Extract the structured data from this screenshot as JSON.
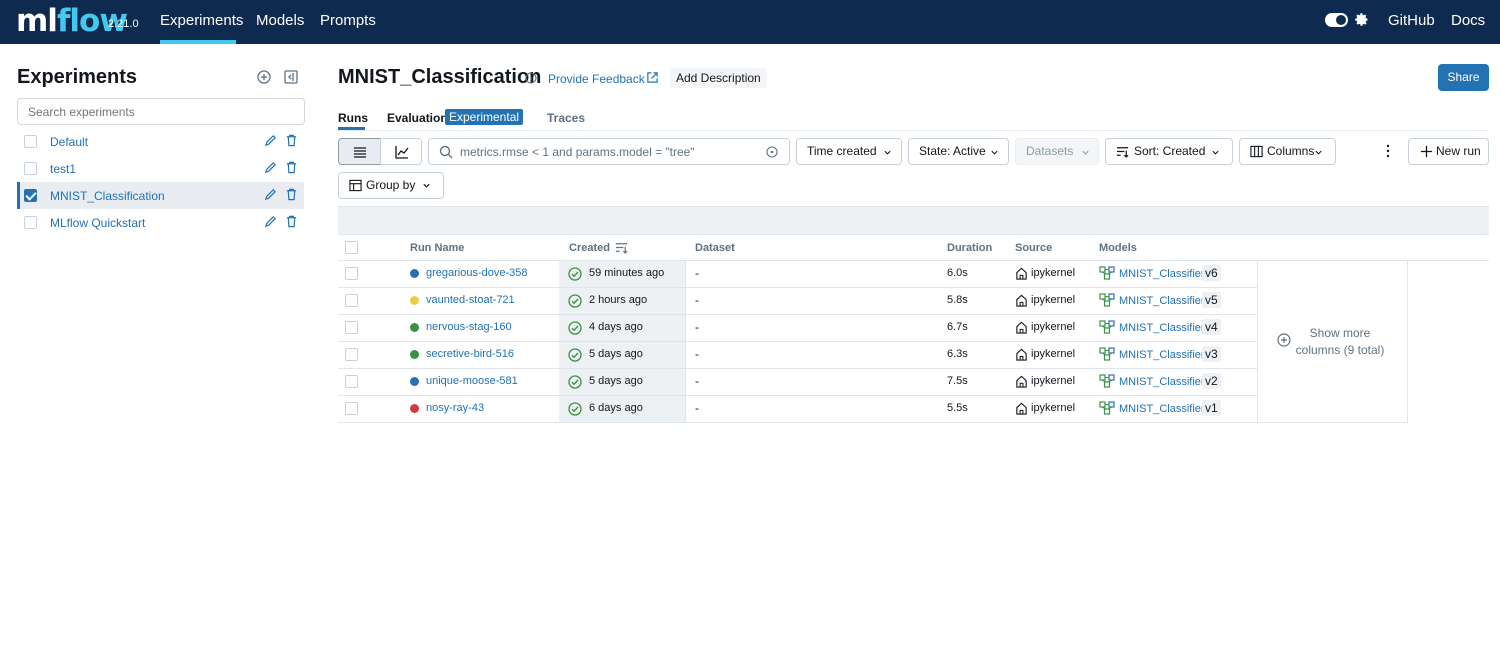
{
  "nav": {
    "logo_ml": "ml",
    "logo_flow": "flow",
    "version": "2.21.0",
    "items": [
      "Experiments",
      "Models",
      "Prompts"
    ],
    "github": "GitHub",
    "docs": "Docs"
  },
  "sidebar": {
    "title": "Experiments",
    "search_placeholder": "Search experiments",
    "experiments": [
      {
        "name": "Default",
        "checked": false
      },
      {
        "name": "test1",
        "checked": false
      },
      {
        "name": "MNIST_Classification",
        "checked": true
      },
      {
        "name": "MLflow Quickstart",
        "checked": false
      }
    ]
  },
  "header": {
    "title": "MNIST_Classification",
    "feedback": "Provide Feedback",
    "add_description": "Add Description",
    "share": "Share"
  },
  "tabs": {
    "runs": "Runs",
    "evaluation": "Evaluation",
    "evaluation_badge": "Experimental",
    "traces": "Traces"
  },
  "toolbar": {
    "filter_placeholder": "metrics.rmse < 1 and params.model = \"tree\"",
    "time_created": "Time created",
    "state": "State: Active",
    "datasets": "Datasets",
    "sort": "Sort: Created",
    "columns": "Columns",
    "new_run": "New run",
    "group_by": "Group by"
  },
  "table": {
    "headers": {
      "run_name": "Run Name",
      "created": "Created",
      "dataset": "Dataset",
      "duration": "Duration",
      "source": "Source",
      "models": "Models"
    },
    "rows": [
      {
        "name": "gregarious-dove-358",
        "color": "#2d6db5",
        "created": "59 minutes ago",
        "dataset": "-",
        "duration": "6.0s",
        "source": "ipykernel_launcher",
        "model": "MNIST_Classifier",
        "version": "v6"
      },
      {
        "name": "vaunted-stoat-721",
        "color": "#f0c94a",
        "created": "2 hours ago",
        "dataset": "-",
        "duration": "5.8s",
        "source": "ipykernel_launcher",
        "model": "MNIST_Classifier",
        "version": "v5"
      },
      {
        "name": "nervous-stag-160",
        "color": "#3a9144",
        "created": "4 days ago",
        "dataset": "-",
        "duration": "6.7s",
        "source": "ipykernel_launcher",
        "model": "MNIST_Classifier",
        "version": "v4"
      },
      {
        "name": "secretive-bird-516",
        "color": "#3a9144",
        "created": "5 days ago",
        "dataset": "-",
        "duration": "6.3s",
        "source": "ipykernel_launcher",
        "model": "MNIST_Classifier",
        "version": "v3"
      },
      {
        "name": "unique-moose-581",
        "color": "#2d6db5",
        "created": "5 days ago",
        "dataset": "-",
        "duration": "7.5s",
        "source": "ipykernel_launcher",
        "model": "MNIST_Classifier",
        "version": "v2"
      },
      {
        "name": "nosy-ray-43",
        "color": "#d13b3b",
        "created": "6 days ago",
        "dataset": "-",
        "duration": "5.5s",
        "source": "ipykernel_launcher",
        "model": "MNIST_Classifier",
        "version": "v1"
      }
    ],
    "show_more": "Show more columns (9 total)"
  },
  "colors": {
    "nav_bg": "#0e2a4f",
    "accent": "#43c9ed",
    "primary": "#2272b4",
    "success": "#3a9144"
  }
}
